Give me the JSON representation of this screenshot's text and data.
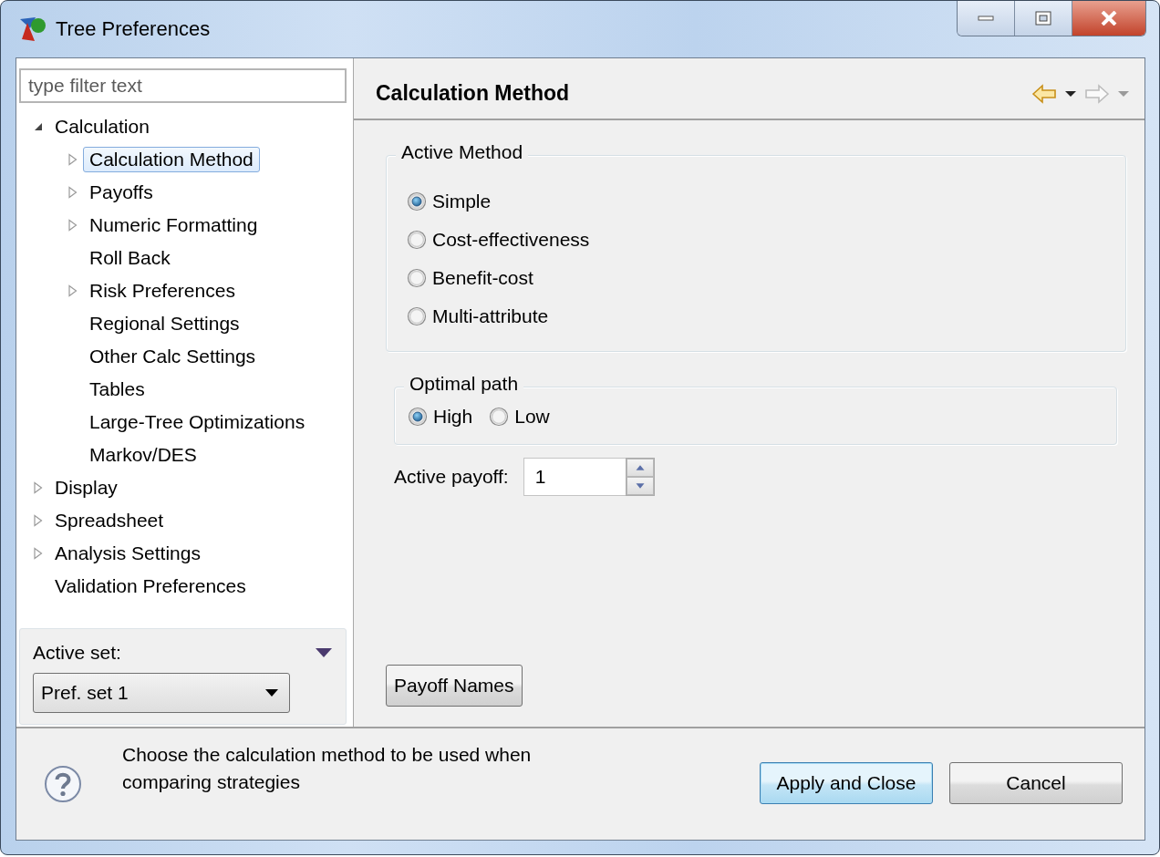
{
  "window": {
    "title": "Tree Preferences"
  },
  "filter": {
    "placeholder": "type filter text"
  },
  "tree": [
    {
      "label": "Calculation",
      "has_children": true,
      "expanded": true,
      "selected": false,
      "children": [
        {
          "label": "Calculation Method",
          "has_children": true,
          "expanded": false,
          "selected": true
        },
        {
          "label": "Payoffs",
          "has_children": true,
          "expanded": false,
          "selected": false
        },
        {
          "label": "Numeric Formatting",
          "has_children": true,
          "expanded": false,
          "selected": false
        },
        {
          "label": "Roll Back",
          "has_children": false,
          "selected": false
        },
        {
          "label": "Risk Preferences",
          "has_children": true,
          "expanded": false,
          "selected": false
        },
        {
          "label": "Regional Settings",
          "has_children": false,
          "selected": false
        },
        {
          "label": "Other Calc Settings",
          "has_children": false,
          "selected": false
        },
        {
          "label": "Tables",
          "has_children": false,
          "selected": false
        },
        {
          "label": "Large-Tree Optimizations",
          "has_children": false,
          "selected": false
        },
        {
          "label": "Markov/DES",
          "has_children": false,
          "selected": false
        }
      ]
    },
    {
      "label": "Display",
      "has_children": true,
      "expanded": false,
      "selected": false
    },
    {
      "label": "Spreadsheet",
      "has_children": true,
      "expanded": false,
      "selected": false
    },
    {
      "label": "Analysis Settings",
      "has_children": true,
      "expanded": false,
      "selected": false
    },
    {
      "label": "Validation Preferences",
      "has_children": false,
      "selected": false
    }
  ],
  "active_set": {
    "label": "Active set:",
    "value": "Pref. set 1"
  },
  "page": {
    "title": "Calculation Method"
  },
  "nav": [
    {
      "kind": "back",
      "enabled": true
    },
    {
      "kind": "forward",
      "enabled": false
    }
  ],
  "active_method": {
    "title": "Active Method",
    "options": [
      {
        "label": "Simple",
        "selected": true
      },
      {
        "label": "Cost-effectiveness",
        "selected": false
      },
      {
        "label": "Benefit-cost",
        "selected": false
      },
      {
        "label": "Multi-attribute",
        "selected": false
      }
    ]
  },
  "optimal_path": {
    "title": "Optimal path",
    "options": [
      {
        "label": "High",
        "selected": true
      },
      {
        "label": "Low",
        "selected": false
      }
    ]
  },
  "active_payoff": {
    "label": "Active payoff:",
    "value": "1"
  },
  "payoff_names_button": "Payoff Names",
  "help_text": "Choose the calculation method to be used when comparing strategies",
  "buttons": [
    {
      "label": "Apply and Close",
      "default": true
    },
    {
      "label": "Cancel",
      "default": false
    }
  ]
}
